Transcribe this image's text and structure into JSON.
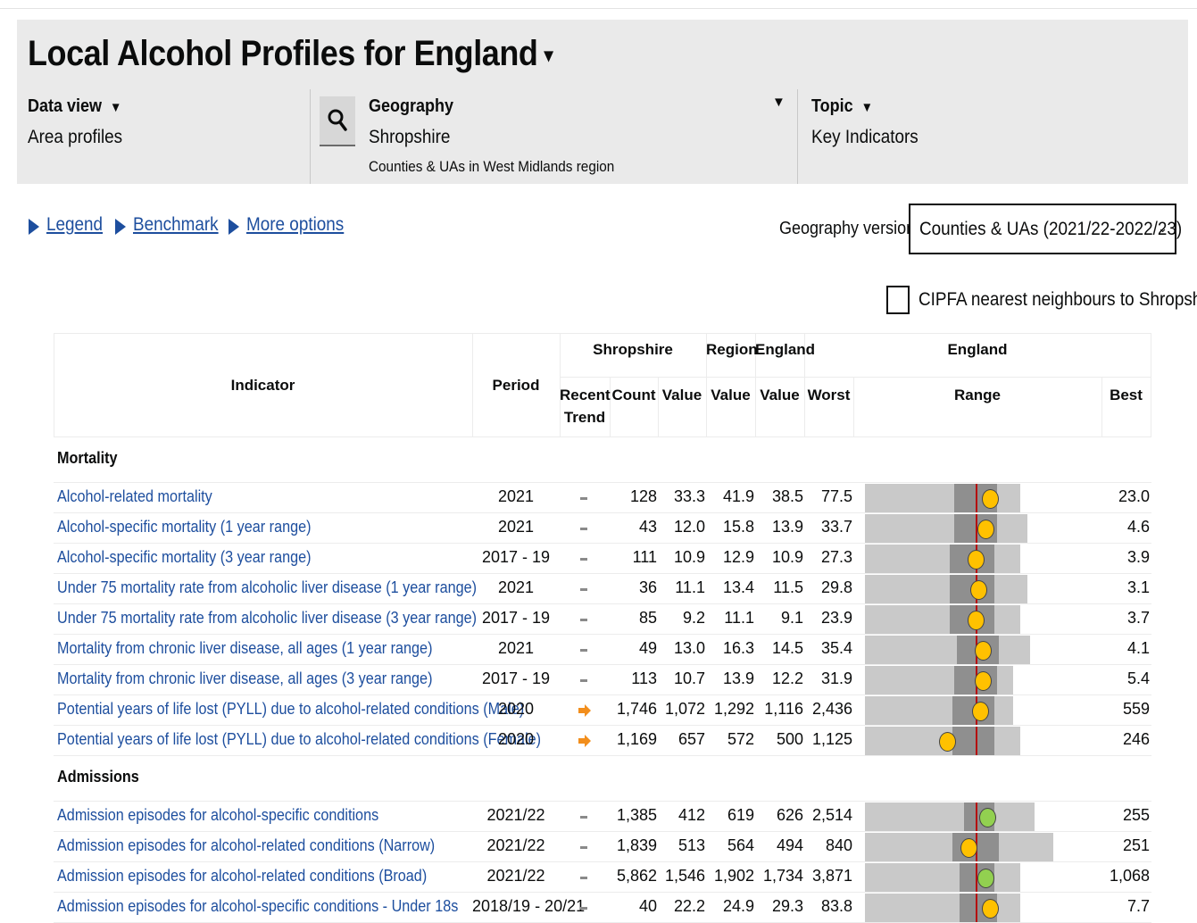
{
  "header": {
    "title": "Local Alcohol Profiles for England",
    "title_caret": "▾",
    "data_view": {
      "label": "Data view",
      "value": "Area profiles"
    },
    "geography": {
      "label": "Geography",
      "value": "Shropshire",
      "sub": "Counties & UAs in West Midlands region"
    },
    "topic": {
      "label": "Topic",
      "value": "Key Indicators"
    },
    "dropdown_caret": "▼"
  },
  "options": {
    "legend": "Legend",
    "benchmark": "Benchmark",
    "more_options": "More options",
    "geography_version_label": "Geography version",
    "geography_version_value": "Counties & UAs (2021/22-2022/23)",
    "select_chevron": "⌄",
    "cipfa_label": "CIPFA nearest neighbours to Shropshire"
  },
  "table": {
    "headers": {
      "indicator": "Indicator",
      "period": "Period",
      "shropshire": "Shropshire",
      "region": "Region",
      "england_group": "England",
      "england_range_group": "England",
      "recent_trend_1": "Recent",
      "recent_trend_2": "Trend",
      "count": "Count",
      "value": "Value",
      "region_value": "Value",
      "england_value": "Value",
      "worst": "Worst",
      "range": "Range",
      "best": "Best"
    },
    "colors": {
      "link": "#1d4e9e",
      "range_light": "#c9c9c9",
      "range_mid": "#8f8f8f",
      "england_line": "#b50e0e",
      "dot_similar": "#ffc100",
      "dot_better": "#92d050",
      "trend_arrow": "#f28e1c"
    },
    "sections": [
      {
        "name": "Mortality",
        "rows": [
          {
            "indicator": "Alcohol-related mortality",
            "period": "2021",
            "trend": "dash",
            "count": "128",
            "value": "33.3",
            "region": "41.9",
            "england": "38.5",
            "worst": "77.5",
            "best": "23.0",
            "dot_pos": 0.53,
            "eng_pos": 0.47,
            "light_end": 0.66,
            "mid_start": 0.38,
            "mid_end": 0.56,
            "dot": "dot_similar"
          },
          {
            "indicator": "Alcohol-specific mortality (1 year range)",
            "period": "2021",
            "trend": "dash",
            "count": "43",
            "value": "12.0",
            "region": "15.8",
            "england": "13.9",
            "worst": "33.7",
            "best": "4.6",
            "dot_pos": 0.51,
            "eng_pos": 0.47,
            "light_end": 0.69,
            "mid_start": 0.38,
            "mid_end": 0.56,
            "dot": "dot_similar"
          },
          {
            "indicator": "Alcohol-specific mortality (3 year range)",
            "period": "2017 - 19",
            "trend": "dash",
            "count": "111",
            "value": "10.9",
            "region": "12.9",
            "england": "10.9",
            "worst": "27.3",
            "best": "3.9",
            "dot_pos": 0.47,
            "eng_pos": 0.47,
            "light_end": 0.66,
            "mid_start": 0.36,
            "mid_end": 0.55,
            "dot": "dot_similar"
          },
          {
            "indicator": "Under 75 mortality rate from alcoholic liver disease (1 year range)",
            "period": "2021",
            "trend": "dash",
            "count": "36",
            "value": "11.1",
            "region": "13.4",
            "england": "11.5",
            "worst": "29.8",
            "best": "3.1",
            "dot_pos": 0.48,
            "eng_pos": 0.47,
            "light_end": 0.69,
            "mid_start": 0.36,
            "mid_end": 0.55,
            "dot": "dot_similar"
          },
          {
            "indicator": "Under 75 mortality rate from alcoholic liver disease (3 year range)",
            "period": "2017 - 19",
            "trend": "dash",
            "count": "85",
            "value": "9.2",
            "region": "11.1",
            "england": "9.1",
            "worst": "23.9",
            "best": "3.7",
            "dot_pos": 0.47,
            "eng_pos": 0.47,
            "light_end": 0.66,
            "mid_start": 0.36,
            "mid_end": 0.55,
            "dot": "dot_similar"
          },
          {
            "indicator": "Mortality from chronic liver disease, all ages (1 year range)",
            "period": "2021",
            "trend": "dash",
            "count": "49",
            "value": "13.0",
            "region": "16.3",
            "england": "14.5",
            "worst": "35.4",
            "best": "4.1",
            "dot_pos": 0.5,
            "eng_pos": 0.47,
            "light_end": 0.7,
            "mid_start": 0.39,
            "mid_end": 0.57,
            "dot": "dot_similar"
          },
          {
            "indicator": "Mortality from chronic liver disease, all ages (3 year range)",
            "period": "2017 - 19",
            "trend": "dash",
            "count": "113",
            "value": "10.7",
            "region": "13.9",
            "england": "12.2",
            "worst": "31.9",
            "best": "5.4",
            "dot_pos": 0.5,
            "eng_pos": 0.47,
            "light_end": 0.63,
            "mid_start": 0.38,
            "mid_end": 0.56,
            "dot": "dot_similar"
          },
          {
            "indicator": "Potential years of life lost (PYLL) due to alcohol-related conditions (Male)",
            "period": "2020",
            "trend": "arrow",
            "count": "1,746",
            "value": "1,072",
            "region": "1,292",
            "england": "1,116",
            "worst": "2,436",
            "best": "559",
            "dot_pos": 0.49,
            "eng_pos": 0.47,
            "light_end": 0.63,
            "mid_start": 0.37,
            "mid_end": 0.55,
            "dot": "dot_similar"
          },
          {
            "indicator": "Potential years of life lost (PYLL) due to alcohol-related conditions (Female)",
            "period": "2020",
            "trend": "arrow",
            "count": "1,169",
            "value": "657",
            "region": "572",
            "england": "500",
            "worst": "1,125",
            "best": "246",
            "dot_pos": 0.35,
            "eng_pos": 0.47,
            "light_end": 0.66,
            "mid_start": 0.37,
            "mid_end": 0.55,
            "dot": "dot_similar"
          }
        ]
      },
      {
        "name": "Admissions",
        "rows": [
          {
            "indicator": "Admission episodes for alcohol-specific conditions",
            "period": "2021/22",
            "trend": "dash",
            "count": "1,385",
            "value": "412",
            "region": "619",
            "england": "626",
            "worst": "2,514",
            "best": "255",
            "dot_pos": 0.52,
            "eng_pos": 0.47,
            "light_end": 0.72,
            "mid_start": 0.42,
            "mid_end": 0.55,
            "dot": "dot_better"
          },
          {
            "indicator": "Admission episodes for alcohol-related conditions (Narrow)",
            "period": "2021/22",
            "trend": "dash",
            "count": "1,839",
            "value": "513",
            "region": "564",
            "england": "494",
            "worst": "840",
            "best": "251",
            "dot_pos": 0.44,
            "eng_pos": 0.47,
            "light_end": 0.8,
            "mid_start": 0.37,
            "mid_end": 0.57,
            "dot": "dot_similar"
          },
          {
            "indicator": "Admission episodes for alcohol-related conditions (Broad)",
            "period": "2021/22",
            "trend": "dash",
            "count": "5,862",
            "value": "1,546",
            "region": "1,902",
            "england": "1,734",
            "worst": "3,871",
            "best": "1,068",
            "dot_pos": 0.51,
            "eng_pos": 0.47,
            "light_end": 0.66,
            "mid_start": 0.4,
            "mid_end": 0.55,
            "dot": "dot_better"
          },
          {
            "indicator": "Admission episodes for alcohol-specific conditions - Under 18s",
            "period": "2018/19 - 20/21",
            "trend": "dash",
            "count": "40",
            "value": "22.2",
            "region": "24.9",
            "england": "29.3",
            "worst": "83.8",
            "best": "7.7",
            "dot_pos": 0.53,
            "eng_pos": 0.47,
            "light_end": 0.66,
            "mid_start": 0.4,
            "mid_end": 0.56,
            "dot": "dot_similar"
          }
        ]
      }
    ]
  }
}
